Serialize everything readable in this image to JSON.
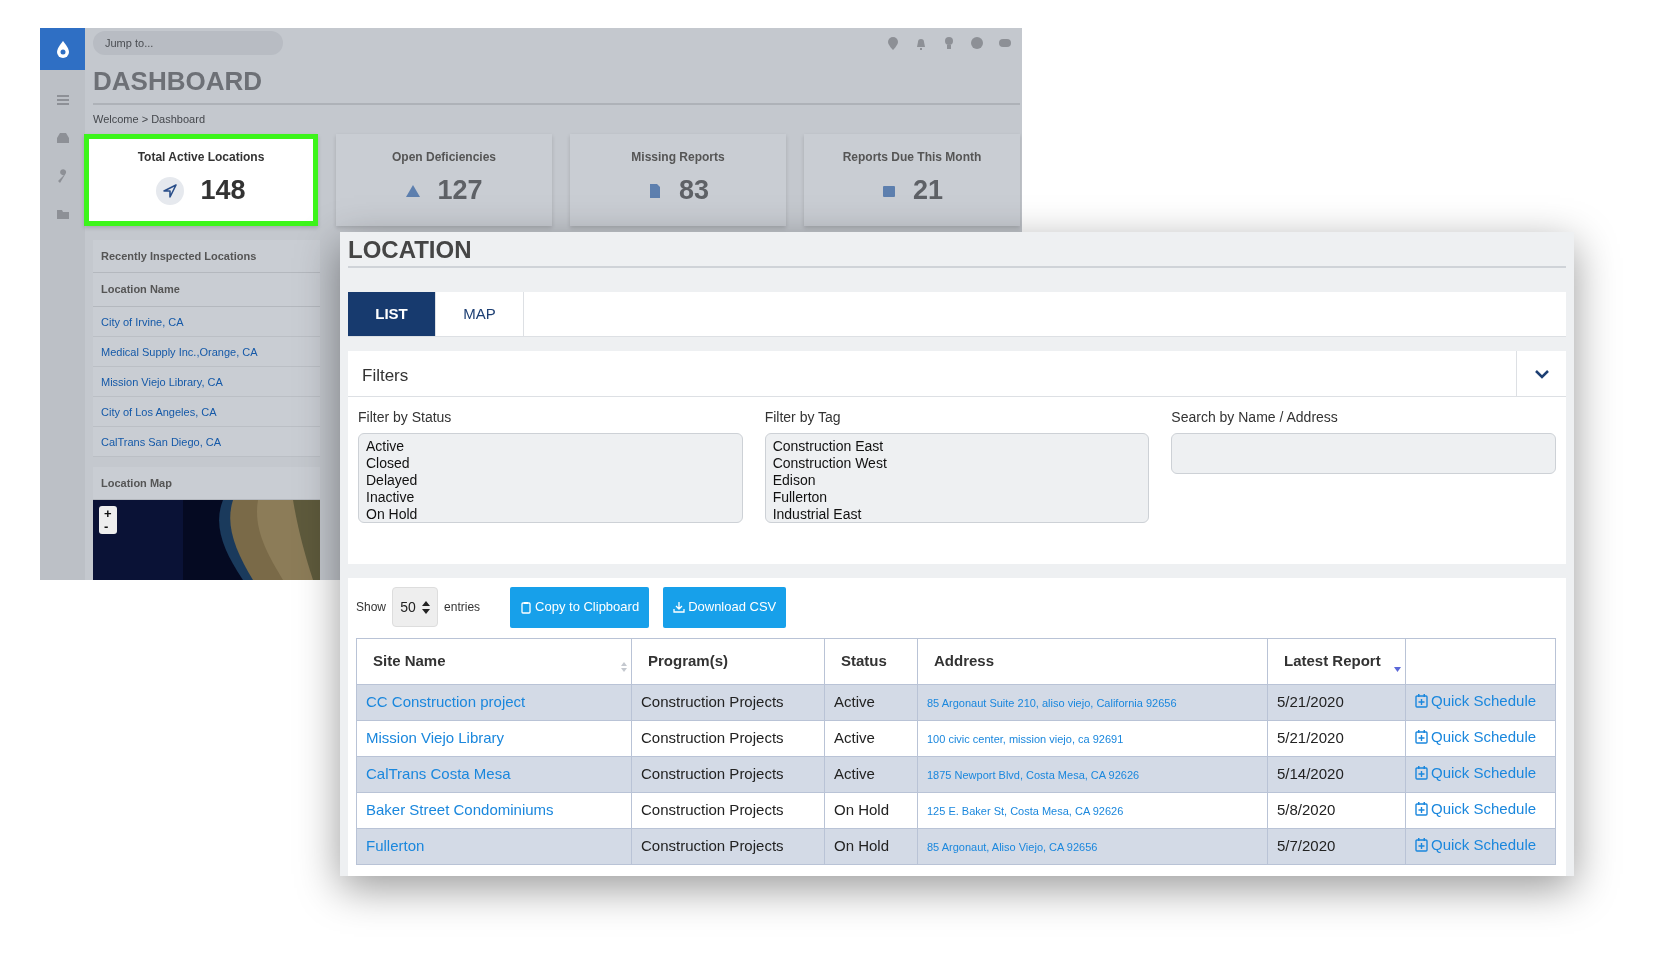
{
  "dashboard": {
    "search": {
      "placeholder": "Jump to..."
    },
    "title": "DASHBOARD",
    "breadcrumb": "Welcome  >  Dashboard",
    "stats": [
      {
        "label": "Total Active Locations",
        "value": "148",
        "highlighted": true
      },
      {
        "label": "Open Deficiencies",
        "value": "127",
        "highlighted": false
      },
      {
        "label": "Missing Reports",
        "value": "83",
        "highlighted": false
      },
      {
        "label": "Reports Due This Month",
        "value": "21",
        "highlighted": false
      }
    ],
    "recent": {
      "title": "Recently Inspected Locations",
      "column": "Location Name",
      "rows": [
        "City of Irvine, CA",
        "Medical Supply Inc.,Orange, CA",
        "Mission Viejo Library, CA",
        "City of Los Angeles, CA",
        "CalTrans San Diego, CA"
      ]
    },
    "map": {
      "title": "Location Map",
      "zoom_in": "+",
      "zoom_out": "-"
    }
  },
  "location": {
    "title": "LOCATION",
    "tabs": [
      {
        "label": "LIST",
        "selected": true
      },
      {
        "label": "MAP",
        "selected": false
      }
    ],
    "filters": {
      "title": "Filters",
      "lists": [
        {
          "label": "Filter by Status",
          "options": [
            "Active",
            "Closed",
            "Delayed",
            "Inactive",
            "On Hold"
          ]
        },
        {
          "label": "Filter by Tag",
          "options": [
            "Construction East",
            "Construction West",
            "Edison",
            "Fullerton",
            "Industrial East"
          ]
        }
      ],
      "search": {
        "label": "Search by Name / Address"
      }
    },
    "tools": {
      "show": "Show",
      "entries_value": "50",
      "entries": "entries",
      "buttons": [
        {
          "label": "Copy to Clipboard",
          "kind": "copy"
        },
        {
          "label": "Download CSV",
          "kind": "download"
        }
      ]
    },
    "table": {
      "columns": [
        {
          "label": "Site Name",
          "sortable": true,
          "sorted_desc": false
        },
        {
          "label": "Program(s)",
          "sortable": false,
          "sorted_desc": false
        },
        {
          "label": "Status",
          "sortable": false,
          "sorted_desc": false
        },
        {
          "label": "Address",
          "sortable": false,
          "sorted_desc": false
        },
        {
          "label": "Latest Report",
          "sortable": true,
          "sorted_desc": true
        },
        {
          "sortable": false,
          "sorted_desc": false
        }
      ],
      "rows": [
        {
          "site": "CC Construction project",
          "program": "Construction Projects",
          "status": "Active",
          "address": "85 Argonaut Suite 210, aliso viejo, California 92656",
          "latest_report": "5/21/2020",
          "action": "Quick Schedule"
        },
        {
          "site": "Mission Viejo Library",
          "program": "Construction Projects",
          "status": "Active",
          "address": "100 civic center, mission viejo, ca 92691",
          "latest_report": "5/21/2020",
          "action": "Quick Schedule"
        },
        {
          "site": "CalTrans Costa Mesa",
          "program": "Construction Projects",
          "status": "Active",
          "address": "1875 Newport Blvd, Costa Mesa, CA 92626",
          "latest_report": "5/14/2020",
          "action": "Quick Schedule"
        },
        {
          "site": "Baker Street Condominiums",
          "program": "Construction Projects",
          "status": "On Hold",
          "address": "125 E. Baker St, Costa Mesa, CA 92626",
          "latest_report": "5/8/2020",
          "action": "Quick Schedule"
        },
        {
          "site": "Fullerton",
          "program": "Construction Projects",
          "status": "On Hold",
          "address": "85 Argonaut, Aliso Viejo, CA 92656",
          "latest_report": "5/7/2020",
          "action": "Quick Schedule"
        }
      ]
    }
  }
}
